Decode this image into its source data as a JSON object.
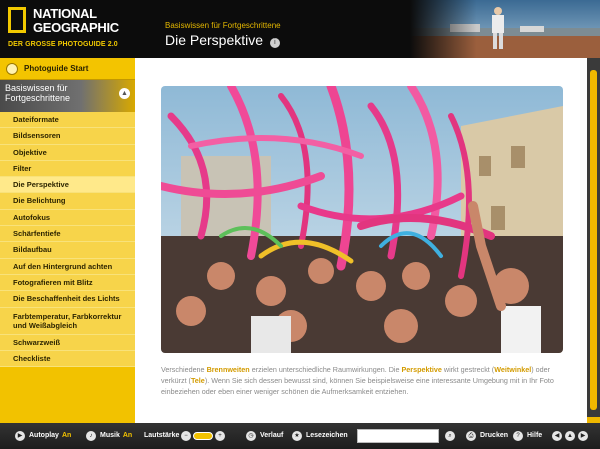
{
  "logo": {
    "line1": "NATIONAL",
    "line2": "GEOGRAPHIC",
    "subtitle": "DER GROSSE PHOTOGUIDE 2.0"
  },
  "header": {
    "chapter": "Basiswissen für Fortgeschrittene",
    "title": "Die Perspektive",
    "title_icon": "i"
  },
  "sidebar": {
    "start_label": "Photoguide Start",
    "section_label": "Basiswissen für Fortgeschrittene",
    "collapse_icon": "▲",
    "items": [
      {
        "label": "Dateiformate"
      },
      {
        "label": "Bildsensoren"
      },
      {
        "label": "Objektive"
      },
      {
        "label": "Filter"
      },
      {
        "label": "Die Perspektive",
        "active": true
      },
      {
        "label": "Die Belichtung"
      },
      {
        "label": "Autofokus"
      },
      {
        "label": "Schärfentiefe"
      },
      {
        "label": "Bildaufbau"
      },
      {
        "label": "Auf den Hintergrund achten"
      },
      {
        "label": "Fotografieren mit Blitz"
      },
      {
        "label": "Die Beschaffenheit des Lichts"
      },
      {
        "label": "Farbtemperatur, Farbkorrektur und Weißabgleich"
      },
      {
        "label": "Schwarzweiß"
      },
      {
        "label": "Checkliste"
      }
    ]
  },
  "caption": {
    "t1": "Verschiedene ",
    "h1": "Brennweiten",
    "t2": " erzielen unterschiedliche Raumwirkungen. Die ",
    "h2": "Perspektive",
    "t3": " wirkt gestreckt (",
    "h3": "Weitwinkel",
    "t4": ") oder verkürzt (",
    "h4": "Tele",
    "t5": "). Wenn Sie sich dessen bewusst sind, können Sie beispielsweise eine interessante Umgebung mit in Ihr Foto einbeziehen oder eben einer weniger schönen die Aufmerksamkeit entziehen."
  },
  "footer": {
    "autoplay_label": "Autoplay",
    "autoplay_state": "An",
    "music_label": "Musik",
    "music_state": "An",
    "volume_label": "Lautstärke",
    "history_label": "Verlauf",
    "bookmarks_label": "Lesezeichen",
    "search_value": "",
    "print_label": "Drucken",
    "help_label": "Hilfe"
  },
  "colors": {
    "accent": "#f2c200",
    "highlight": "#d39b00"
  }
}
